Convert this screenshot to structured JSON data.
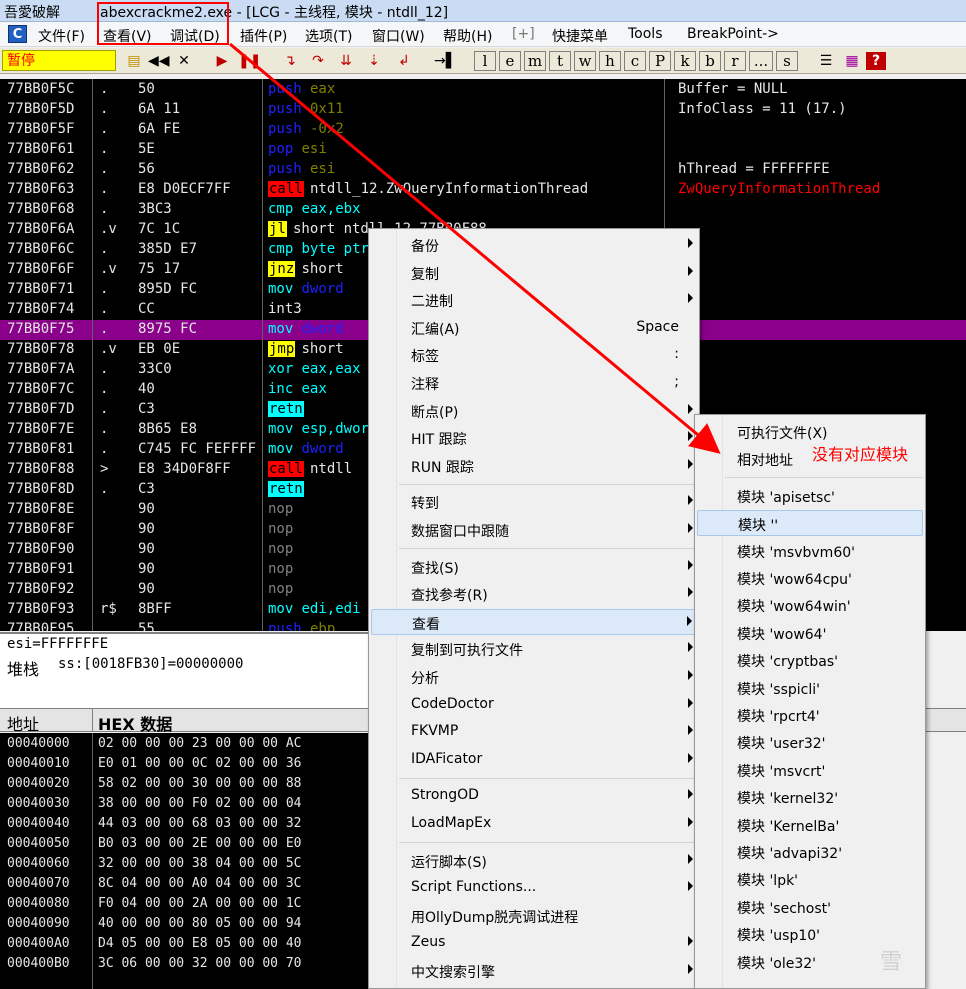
{
  "window": {
    "app_name": "吾愛破解",
    "title": "abexcrackme2.exe - [LCG - 主线程, 模块 - ntdll_12]"
  },
  "menu": {
    "logo": "C",
    "items": [
      "文件(F)",
      "查看(V)",
      "调试(D)",
      "插件(P)",
      "选项(T)",
      "窗口(W)",
      "帮助(H)",
      "[+]",
      "快捷菜单",
      "Tools",
      "BreakPoint->"
    ]
  },
  "toolbar": {
    "status": "暂停",
    "letter_buttons": [
      "l",
      "e",
      "m",
      "t",
      "w",
      "h",
      "c",
      "P",
      "k",
      "b",
      "r",
      "...",
      "s"
    ]
  },
  "disasm": [
    {
      "addr": "77BB0F5C",
      "mark": ".",
      "hex": "50",
      "op": "push",
      "args": "eax",
      "opc": "blue",
      "argc": "olive"
    },
    {
      "addr": "77BB0F5D",
      "mark": ".",
      "hex": "6A 11",
      "op": "push",
      "args": "0x11",
      "opc": "blue",
      "argc": "olive"
    },
    {
      "addr": "77BB0F5F",
      "mark": ".",
      "hex": "6A FE",
      "op": "push",
      "args": "-0x2",
      "opc": "blue",
      "argc": "olive"
    },
    {
      "addr": "77BB0F61",
      "mark": ".",
      "hex": "5E",
      "op": "pop",
      "args": "esi",
      "opc": "blue",
      "argc": "olive"
    },
    {
      "addr": "77BB0F62",
      "mark": ".",
      "hex": "56",
      "op": "push",
      "args": "esi",
      "opc": "blue",
      "argc": "olive"
    },
    {
      "addr": "77BB0F63",
      "mark": ".",
      "hex": "E8 D0ECF7FF",
      "op": "call",
      "args": "ntdll_12.ZwQueryInformationThread",
      "opc": "red",
      "argc": "plain"
    },
    {
      "addr": "77BB0F68",
      "mark": ".",
      "hex": "3BC3",
      "op": "cmp",
      "args": "eax,ebx",
      "opc": "cyan",
      "argc": "cyan"
    },
    {
      "addr": "77BB0F6A",
      "mark": ".v",
      "hex": "7C 1C",
      "op": "jl",
      "args": "short ntdll_12.77BB0F88",
      "opc": "yellow",
      "argc": "plain"
    },
    {
      "addr": "77BB0F6C",
      "mark": ".",
      "hex": "385D E7",
      "op": "cmp",
      "args": "byte ptr",
      "opc": "cyan",
      "argc": "cyan"
    },
    {
      "addr": "77BB0F6F",
      "mark": ".v",
      "hex": "75 17",
      "op": "jnz",
      "args": "short",
      "opc": "yellow",
      "argc": "plain"
    },
    {
      "addr": "77BB0F71",
      "mark": ".",
      "hex": "895D FC",
      "op": "mov",
      "args": "dword",
      "opc": "cyan",
      "argc": "blue"
    },
    {
      "addr": "77BB0F74",
      "mark": ".",
      "hex": "CC",
      "op": "int3",
      "args": "",
      "opc": "plain",
      "argc": "plain"
    },
    {
      "addr": "77BB0F75",
      "mark": ".",
      "hex": "8975 FC",
      "op": "mov",
      "args": "dword",
      "opc": "cyan",
      "argc": "blue",
      "selected": true
    },
    {
      "addr": "77BB0F78",
      "mark": ".v",
      "hex": "EB 0E",
      "op": "jmp",
      "args": "short",
      "opc": "yellow",
      "argc": "plain"
    },
    {
      "addr": "77BB0F7A",
      "mark": ".",
      "hex": "33C0",
      "op": "xor",
      "args": "eax,eax",
      "opc": "cyan",
      "argc": "cyan"
    },
    {
      "addr": "77BB0F7C",
      "mark": ".",
      "hex": "40",
      "op": "inc",
      "args": "eax",
      "opc": "cyan",
      "argc": "cyan"
    },
    {
      "addr": "77BB0F7D",
      "mark": ".",
      "hex": "C3",
      "op": "retn",
      "args": "",
      "opc": "cyanbg",
      "argc": "plain"
    },
    {
      "addr": "77BB0F7E",
      "mark": ".",
      "hex": "8B65 E8",
      "op": "mov",
      "args": "esp,dword",
      "opc": "cyan",
      "argc": "cyan"
    },
    {
      "addr": "77BB0F81",
      "mark": ".",
      "hex": "C745 FC FEFFFF",
      "op": "mov",
      "args": "dword",
      "opc": "cyan",
      "argc": "blue"
    },
    {
      "addr": "77BB0F88",
      "mark": ">",
      "hex": "E8 34D0F8FF",
      "op": "call",
      "args": "ntdll",
      "opc": "red",
      "argc": "plain"
    },
    {
      "addr": "77BB0F8D",
      "mark": ".",
      "hex": "C3",
      "op": "retn",
      "args": "",
      "opc": "cyanbg",
      "argc": "plain"
    },
    {
      "addr": "77BB0F8E",
      "mark": "",
      "hex": "90",
      "op": "nop",
      "args": "",
      "opc": "gray",
      "argc": "plain"
    },
    {
      "addr": "77BB0F8F",
      "mark": "",
      "hex": "90",
      "op": "nop",
      "args": "",
      "opc": "gray",
      "argc": "plain"
    },
    {
      "addr": "77BB0F90",
      "mark": "",
      "hex": "90",
      "op": "nop",
      "args": "",
      "opc": "gray",
      "argc": "plain"
    },
    {
      "addr": "77BB0F91",
      "mark": "",
      "hex": "90",
      "op": "nop",
      "args": "",
      "opc": "gray",
      "argc": "plain"
    },
    {
      "addr": "77BB0F92",
      "mark": "",
      "hex": "90",
      "op": "nop",
      "args": "",
      "opc": "gray",
      "argc": "plain"
    },
    {
      "addr": "77BB0F93",
      "mark": "r$",
      "hex": "8BFF",
      "op": "mov",
      "args": "edi,edi",
      "opc": "cyan",
      "argc": "cyan"
    },
    {
      "addr": "77BB0F95",
      "mark": "",
      "hex": "55",
      "op": "push",
      "args": "ebp",
      "opc": "blue",
      "argc": "olive"
    }
  ],
  "comments": [
    {
      "text": "Buffer = NULL",
      "color": "plain"
    },
    {
      "text": "InfoClass = 11 (17.)",
      "color": "plain"
    },
    {
      "text": "",
      "color": "plain"
    },
    {
      "text": "",
      "color": "plain"
    },
    {
      "text": "hThread = FFFFFFFE",
      "color": "plain"
    },
    {
      "text": "ZwQueryInformationThread",
      "color": "red"
    }
  ],
  "info": {
    "line1": "esi=FFFFFFFE",
    "line2_label": "堆栈",
    "line2_value": "ss:[0018FB30]=00000000"
  },
  "dump": {
    "col_addr": "地址",
    "col_hex": "HEX 数据",
    "rows": [
      {
        "addr": "00040000",
        "b": "02 00 00 00 23 00 00 00 AC"
      },
      {
        "addr": "00040010",
        "b": "E0 01 00 00 0C 02 00 00 36"
      },
      {
        "addr": "00040020",
        "b": "58 02 00 00 30 00 00 00 88"
      },
      {
        "addr": "00040030",
        "b": "38 00 00 00 F0 02 00 00 04"
      },
      {
        "addr": "00040040",
        "b": "44 03 00 00 68 03 00 00 32"
      },
      {
        "addr": "00040050",
        "b": "B0 03 00 00 2E 00 00 00 E0"
      },
      {
        "addr": "00040060",
        "b": "32 00 00 00 38 04 00 00 5C"
      },
      {
        "addr": "00040070",
        "b": "8C 04 00 00 A0 04 00 00 3C"
      },
      {
        "addr": "00040080",
        "b": "F0 04 00 00 2A 00 00 00 1C"
      },
      {
        "addr": "00040090",
        "b": "40 00 00 00 80 05 00 00 94"
      },
      {
        "addr": "000400A0",
        "b": "D4 05 00 00 E8 05 00 00 40"
      },
      {
        "addr": "000400B0",
        "b": "3C 06 00 00 32 00 00 00 70"
      }
    ]
  },
  "context_menu": [
    {
      "label": "备份",
      "arrow": true
    },
    {
      "label": "复制",
      "arrow": true
    },
    {
      "label": "二进制",
      "arrow": true
    },
    {
      "label": "汇编(A)",
      "shortcut": "Space"
    },
    {
      "label": "标签",
      "shortcut": ":"
    },
    {
      "label": "注释",
      "shortcut": ";"
    },
    {
      "label": "断点(P)",
      "arrow": true
    },
    {
      "label": "HIT 跟踪",
      "arrow": true
    },
    {
      "label": "RUN 跟踪",
      "arrow": true
    },
    {
      "sep": true
    },
    {
      "label": "转到",
      "arrow": true
    },
    {
      "label": "数据窗口中跟随",
      "arrow": true
    },
    {
      "sep": true
    },
    {
      "label": "查找(S)",
      "arrow": true
    },
    {
      "label": "查找参考(R)",
      "arrow": true
    },
    {
      "label": "查看",
      "arrow": true,
      "hover": true
    },
    {
      "label": "复制到可执行文件",
      "arrow": true
    },
    {
      "label": "分析",
      "arrow": true
    },
    {
      "label": "CodeDoctor",
      "arrow": true
    },
    {
      "label": "FKVMP",
      "arrow": true
    },
    {
      "label": "IDAFicator",
      "arrow": true
    },
    {
      "sep": true
    },
    {
      "label": "StrongOD",
      "arrow": true
    },
    {
      "label": "LoadMapEx",
      "arrow": true
    },
    {
      "sep": true
    },
    {
      "label": "运行脚本(S)",
      "arrow": true
    },
    {
      "label": "Script Functions...",
      "arrow": true
    },
    {
      "label": "用OllyDump脱壳调试进程"
    },
    {
      "label": "Zeus",
      "arrow": true
    },
    {
      "label": "中文搜索引擎",
      "arrow": true
    }
  ],
  "submenu": [
    {
      "label": "可执行文件(X)"
    },
    {
      "label": "相对地址"
    },
    {
      "sep": true
    },
    {
      "label": "模块 'apisetsc'"
    },
    {
      "label": "模块 ''",
      "hover": true
    },
    {
      "label": "模块 'msvbvm60'"
    },
    {
      "label": "模块 'wow64cpu'"
    },
    {
      "label": "模块 'wow64win'"
    },
    {
      "label": "模块 'wow64'"
    },
    {
      "label": "模块 'cryptbas'"
    },
    {
      "label": "模块 'sspicli'"
    },
    {
      "label": "模块 'rpcrt4'"
    },
    {
      "label": "模块 'user32'"
    },
    {
      "label": "模块 'msvcrt'"
    },
    {
      "label": "模块 'kernel32'"
    },
    {
      "label": "模块 'KernelBa'"
    },
    {
      "label": "模块 'advapi32'"
    },
    {
      "label": "模块 'lpk'"
    },
    {
      "label": "模块 'sechost'"
    },
    {
      "label": "模块 'usp10'"
    },
    {
      "label": "模块 'ole32'"
    }
  ],
  "annotation": {
    "text": "没有对应模块",
    "color": "#ff0000"
  },
  "watermark": "雪",
  "colors": {
    "selected_row": "#8b008b",
    "status_bg": "#ffff00",
    "status_fg": "#ff0000"
  }
}
